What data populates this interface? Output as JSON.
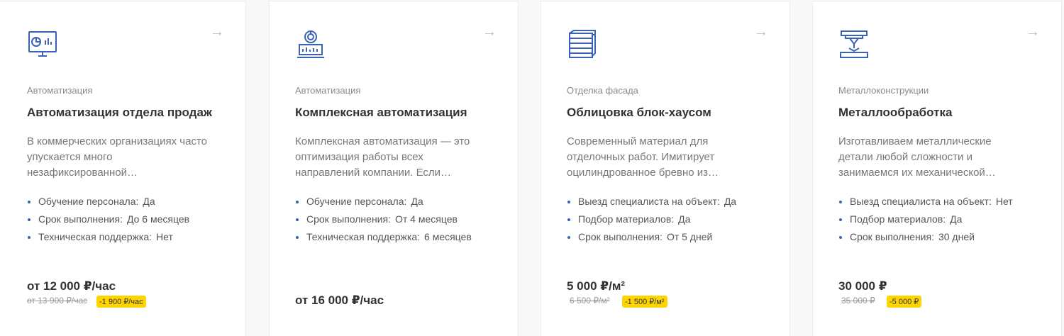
{
  "cards": [
    {
      "section": "Автоматизация",
      "title": "Автоматизация отдела продаж",
      "description": "В коммерческих организациях часто упускается много незафиксированной…",
      "props": [
        {
          "label": "Обучение персонала:",
          "value": "Да"
        },
        {
          "label": "Срок выполнения:",
          "value": "До 6 месяцев"
        },
        {
          "label": "Техническая поддержка:",
          "value": "Нет"
        }
      ],
      "price": "от 12 000 ₽/час",
      "old_price": "от 13 900 ₽/час",
      "discount": "-1 900 ₽/час",
      "icon": "analytics-monitor-icon"
    },
    {
      "section": "Автоматизация",
      "title": "Комплексная автоматизация",
      "description": "Комплексная автоматизация — это оптимизация работы всех направлений компании. Если…",
      "props": [
        {
          "label": "Обучение персонала:",
          "value": "Да"
        },
        {
          "label": "Срок выполнения:",
          "value": "От 4 месяцев"
        },
        {
          "label": "Техническая поддержка:",
          "value": "6 месяцев"
        }
      ],
      "price": "от 16 000 ₽/час",
      "icon": "dashboard-chart-icon"
    },
    {
      "section": "Отделка фасада",
      "title": "Облицовка блок-хаусом",
      "description": "Современный материал для отделочных работ. Имитирует оцилиндрованное бревно из…",
      "props": [
        {
          "label": "Выезд специалиста на объект:",
          "value": "Да"
        },
        {
          "label": "Подбор материалов:",
          "value": "Да"
        },
        {
          "label": "Срок выполнения:",
          "value": "От 5 дней"
        }
      ],
      "price": "5 000 ₽/м²",
      "old_price": "6 500 ₽/м²",
      "discount": "-1 500 ₽/м²",
      "icon": "facade-panels-icon"
    },
    {
      "section": "Металлоконструкции",
      "title": "Металлообработка",
      "description": "Изготавливаем металлические детали любой сложности и занимаемся их механической…",
      "props": [
        {
          "label": "Выезд специалиста на объект:",
          "value": "Нет"
        },
        {
          "label": "Подбор материалов:",
          "value": "Да"
        },
        {
          "label": "Срок выполнения:",
          "value": "30 дней"
        }
      ],
      "price": "30 000 ₽",
      "old_price": "35 000 ₽",
      "discount": "-5 000 ₽",
      "icon": "laser-cutter-icon"
    }
  ],
  "arrow_glyph": "→",
  "colors": {
    "accent": "#3a62b8",
    "discount_bg": "#ffd400"
  }
}
